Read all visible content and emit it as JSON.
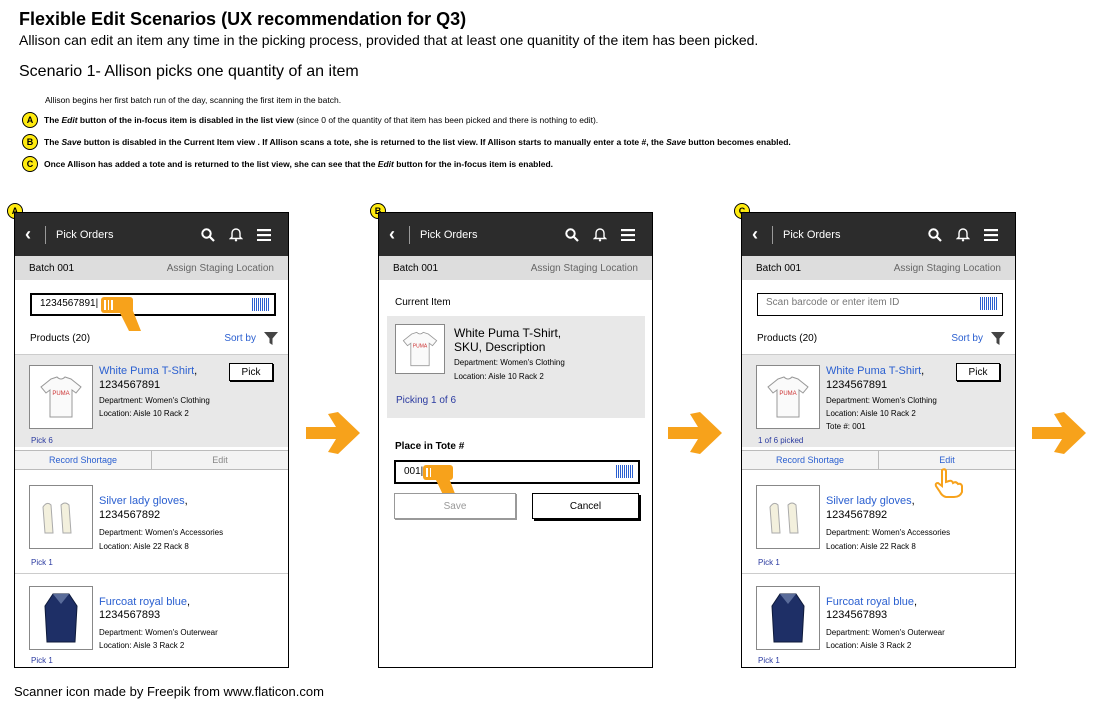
{
  "header": {
    "title": "Flexible Edit Scenarios (UX recommendation for Q3)",
    "subtitle": "Allison can edit an item any time in the picking process, provided that at least one quanitity of the item has been picked.",
    "scenario": "Scenario 1- Allison picks one quantity of an item",
    "intro": "Allison begins her first batch run of the day, scanning the first item in the batch."
  },
  "notes": [
    {
      "badge": "A",
      "pre": "The ",
      "em": "Edit",
      "post": " button of the in-focus item is disabled in the list view",
      "tail": " (since 0 of the quantity of that item has been picked and there is nothing to edit)."
    },
    {
      "badge": "B",
      "pre": "The ",
      "em": "Save",
      "post": " button is disabled in the Current Item view .  If Allison scans a tote, she is returned to the list view.  If Allison starts to manually enter a tote #, the ",
      "em2": "Save",
      "post2": " button becomes enabled."
    },
    {
      "badge": "C",
      "pre": "Once Allison has added a tote and is returned to the list view, she can see that the ",
      "em": "Edit",
      "post": " button for the in-focus item is enabled."
    }
  ],
  "appbar": {
    "title": "Pick Orders"
  },
  "batch": {
    "name": "Batch 001",
    "assign": "Assign Staging Location"
  },
  "screenA": {
    "badge": "A",
    "scan_value": "1234567891|",
    "products_label": "Products (20)",
    "sort_label": "Sort by",
    "pick_button": "Pick",
    "record_shortage": "Record Shortage",
    "edit": "Edit",
    "items": [
      {
        "name": "White Puma T-Shirt",
        "sku": "1234567891",
        "dept": "Department: Women's Clothing",
        "loc": "Location: Aisle 10 Rack 2",
        "pick": "Pick 6"
      },
      {
        "name": "Silver lady gloves",
        "sku": "1234567892",
        "dept": "Department: Women's Accessories",
        "loc": "Location: Aisle 22 Rack 8",
        "pick": "Pick 1"
      },
      {
        "name": "Furcoat royal blue",
        "sku": "1234567893",
        "dept": "Department: Women's Outerwear",
        "loc": "Location: Aisle 3 Rack 2",
        "pick": "Pick 1"
      }
    ]
  },
  "screenB": {
    "badge": "B",
    "current_item_label": "Current Item",
    "item_title_line1": "White Puma T-Shirt,",
    "item_title_line2": "SKU, Description",
    "dept": "Department: Women's Clothing",
    "loc": "Location: Aisle 10 Rack 2",
    "picking": "Picking 1 of 6",
    "tote_label": "Place in Tote #",
    "tote_value": "001|",
    "save": "Save",
    "cancel": "Cancel"
  },
  "screenC": {
    "badge": "C",
    "scan_placeholder": "Scan barcode or enter item ID",
    "products_label": "Products (20)",
    "sort_label": "Sort by",
    "pick_button": "Pick",
    "record_shortage": "Record Shortage",
    "edit": "Edit",
    "tote": "Tote #: 001",
    "picked": "1 of 6 picked"
  },
  "footer": "Scanner icon made by Freepik from www.flaticon.com",
  "colors": {
    "link": "#2a5fd0",
    "badge": "#ffeb0f",
    "arrow": "#f7a21b",
    "appbar": "#2c2c2c"
  }
}
